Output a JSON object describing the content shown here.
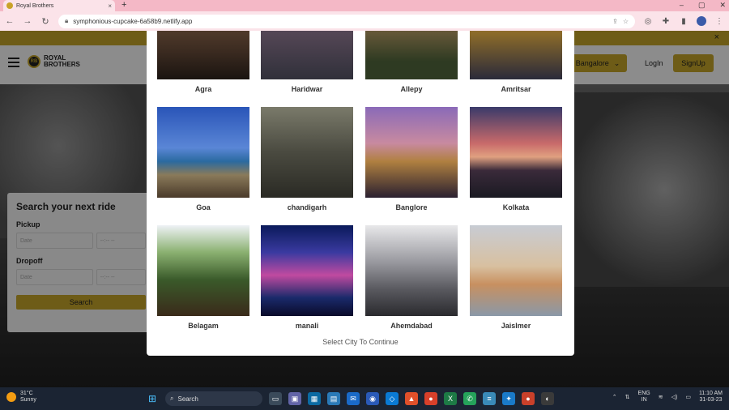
{
  "browser": {
    "tab_title": "Royal Brothers",
    "tab_close": "×",
    "new_tab": "+",
    "url": "symphonious-cupcake-6a58b9.netlify.app",
    "window_controls": [
      "–",
      "▢",
      "✕"
    ]
  },
  "banner": {
    "close": "×"
  },
  "header": {
    "brand_line1": "ROYAL",
    "brand_line2": "BROTHERS",
    "city_button": "Bangalore",
    "login": "LogIn",
    "signup": "SignUp"
  },
  "search_card": {
    "title": "Search your next ride",
    "pickup_label": "Pickup",
    "dropoff_label": "Dropoff",
    "date_placeholder": "Date",
    "time_placeholder": "--:-- --",
    "search_button": "Search"
  },
  "modal": {
    "cities": [
      {
        "name": "Agra",
        "icon": "agra-photo"
      },
      {
        "name": "Haridwar",
        "icon": "haridwar-photo"
      },
      {
        "name": "Allepy",
        "icon": "allepy-photo"
      },
      {
        "name": "Amritsar",
        "icon": "amritsar-photo"
      },
      {
        "name": "Goa",
        "icon": "goa-photo"
      },
      {
        "name": "chandigarh",
        "icon": "chandigarh-photo"
      },
      {
        "name": "Banglore",
        "icon": "banglore-photo"
      },
      {
        "name": "Kolkata",
        "icon": "kolkata-photo"
      },
      {
        "name": "Belagam",
        "icon": "belagam-photo"
      },
      {
        "name": "manali",
        "icon": "manali-photo"
      },
      {
        "name": "Ahemdabad",
        "icon": "ahemdabad-photo"
      },
      {
        "name": "Jaislmer",
        "icon": "jaislmer-photo"
      }
    ],
    "footer": "Select City To Continue"
  },
  "taskbar": {
    "temp": "31°C",
    "weather": "Sunny",
    "search": "Search",
    "lang1": "ENG",
    "lang2": "IN",
    "time": "11:10 AM",
    "date": "31-03-23"
  },
  "colors": {
    "accent": "#c8a82a",
    "tab_strip": "#f4b8c6",
    "taskbar": "#1b2433"
  }
}
